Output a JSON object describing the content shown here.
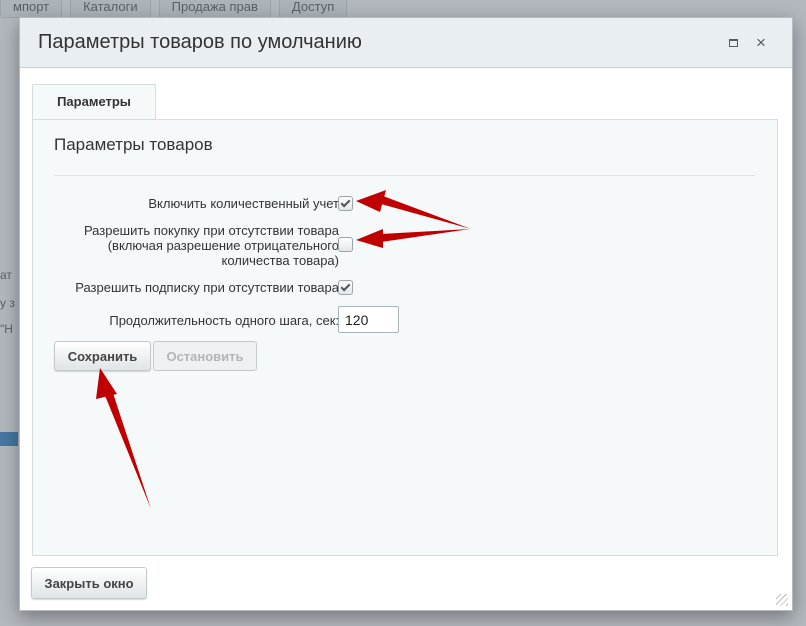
{
  "background": {
    "tabs": [
      "мпорт",
      "Каталоги",
      "Продажа прав",
      "Доступ"
    ],
    "fragments": [
      "ат",
      "у з",
      "\"Н"
    ]
  },
  "dialog": {
    "title": "Параметры товаров по умолчанию",
    "maximize_icon": "maximize-icon",
    "close_icon": "close-icon",
    "tab_label": "Параметры",
    "panel_title": "Параметры товаров",
    "fields": {
      "quantity_tracking": {
        "label": "Включить количественный учет",
        "checked": true
      },
      "allow_purchase": {
        "label_lines": [
          "Разрешить покупку при отсутствии товара",
          "(включая разрешение отрицательного",
          "количества товара)"
        ],
        "checked": false
      },
      "allow_subscription": {
        "label": "Разрешить подписку при отсутствии товара",
        "checked": true
      },
      "step_duration": {
        "label": "Продолжительность одного шага, сек:",
        "value": "120"
      }
    },
    "buttons": {
      "save": "Сохранить",
      "stop": "Остановить",
      "close_window": "Закрыть окно"
    }
  },
  "colors": {
    "header_bg": "#e8eef1",
    "panel_bg": "#f5f9f9",
    "annotation_arrow": "#c00000"
  }
}
